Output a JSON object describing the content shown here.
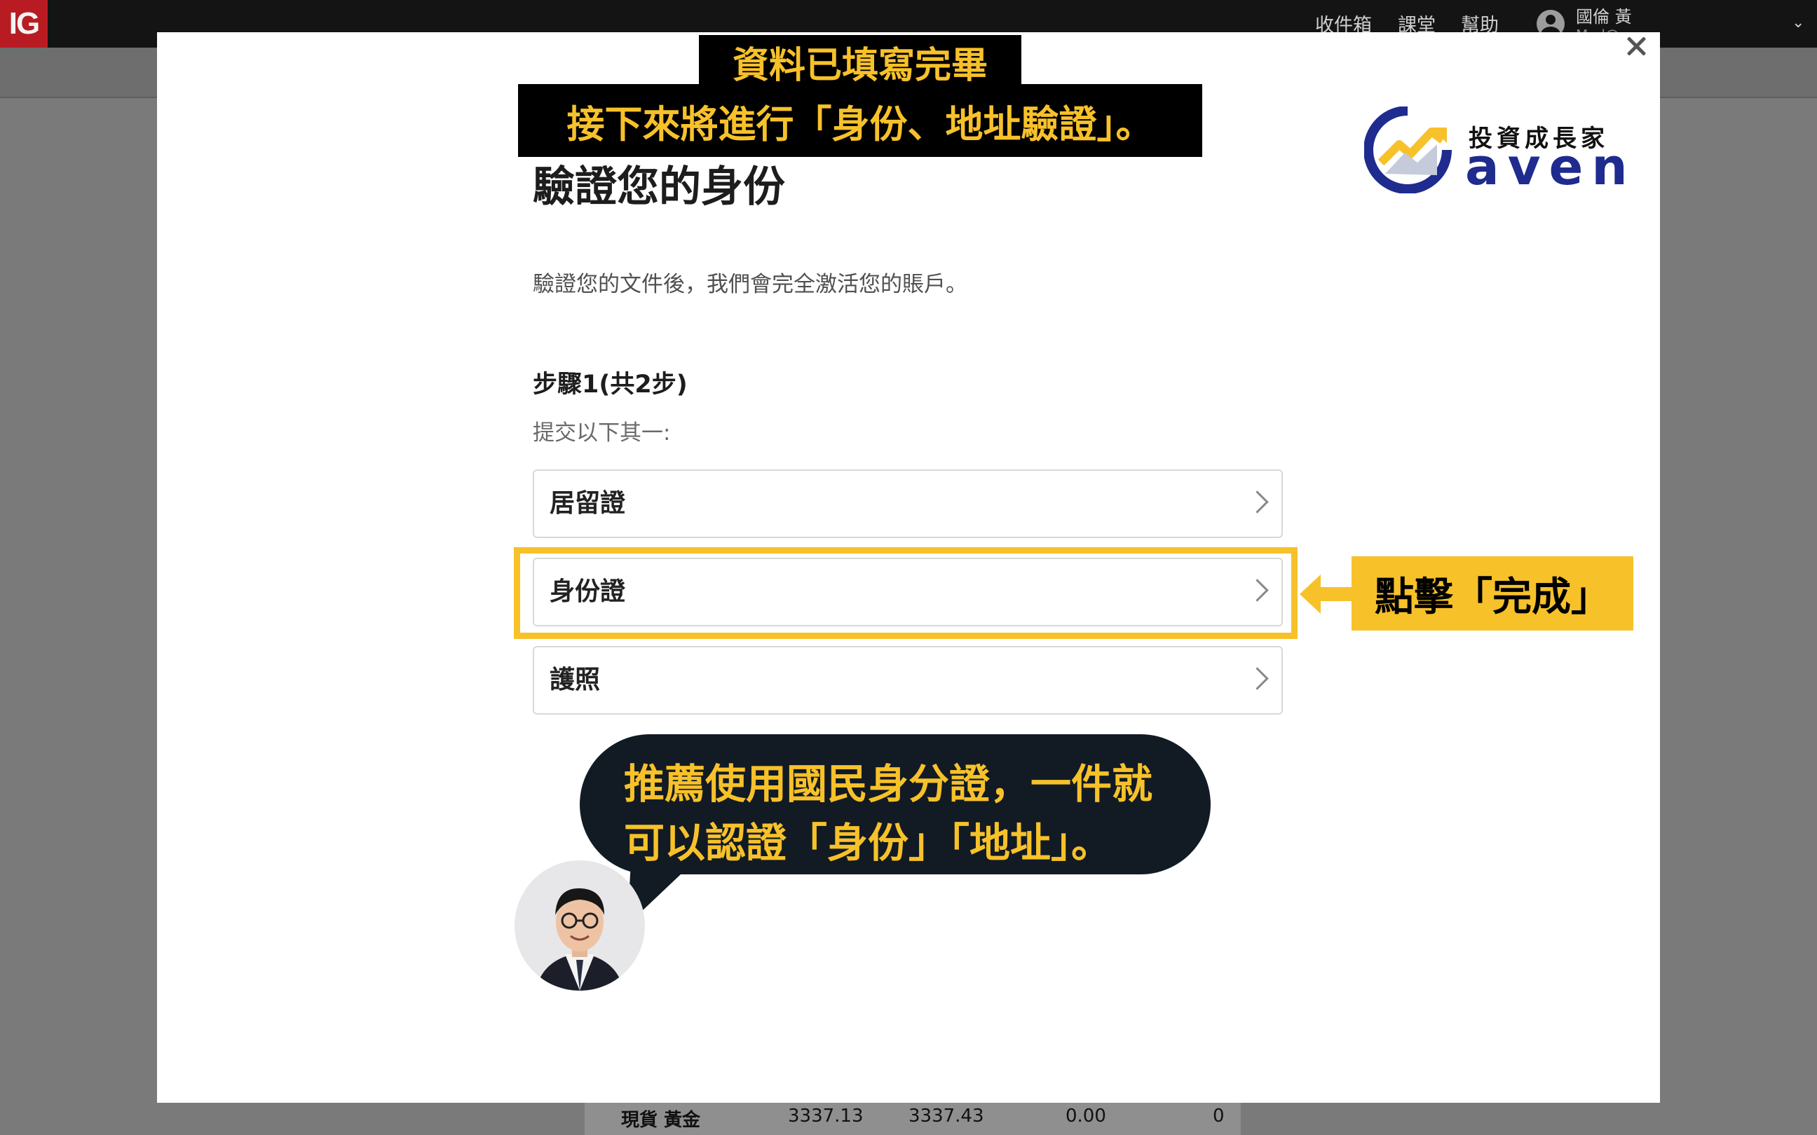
{
  "app": {
    "logo": "IG"
  },
  "topbar": {
    "nav": [
      "收件箱",
      "課堂",
      "幫助"
    ],
    "user_name": "國倫 黃",
    "user_sub": "M...l@...",
    "chevron": "⌄"
  },
  "background_table": {
    "row": {
      "name": "現貨 黃金",
      "sell": "3337.13",
      "buy": "3337.43",
      "change": "0.00",
      "qty": "0"
    }
  },
  "modal": {
    "close_icon": "close-icon",
    "title": "驗證您的身份",
    "description": "驗證您的文件後，我們會完全激活您的賬戶。",
    "step": "步驟1(共2步)",
    "instruction": "提交以下其一:",
    "options": [
      {
        "label": "居留證"
      },
      {
        "label": "身份證"
      },
      {
        "label": "護照"
      }
    ]
  },
  "annotations": {
    "top_line1": "資料已填寫完畢",
    "top_line2": "接下來將進行「身份、地址驗證」。",
    "click_hint": "點擊「完成」",
    "bubble_line1": "推薦使用國民身分證，一件就",
    "bubble_line2": "可以認證「身份」「地址」。",
    "highlight_color": "#f7c12a"
  },
  "brand": {
    "name_cn": "投資成長家",
    "name_en": "aven"
  },
  "colors": {
    "ig_red": "#b81c22",
    "annotation_yellow": "#f7c12a",
    "bubble_bg": "#121b24",
    "logo_blue": "#1f2b8e"
  }
}
